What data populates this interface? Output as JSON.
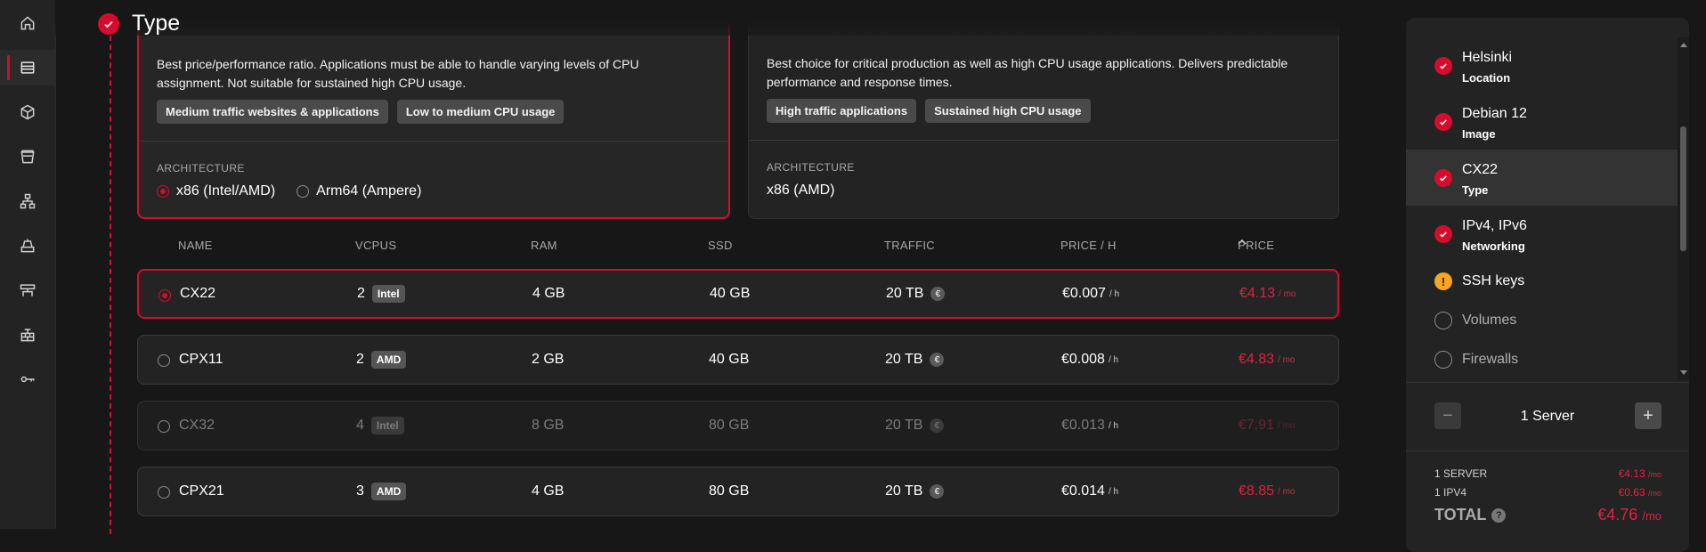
{
  "section": {
    "title": "Type"
  },
  "type_cards": [
    {
      "description": "Best price/performance ratio. Applications must be able to handle varying levels of CPU assignment. Not suitable for sustained high CPU usage.",
      "tags": [
        "Medium traffic websites & applications",
        "Low to medium CPU usage"
      ],
      "arch_label": "ARCHITECTURE",
      "arch_options": [
        "x86 (Intel/AMD)",
        "Arm64 (Ampere)"
      ]
    },
    {
      "description": "Best choice for critical production as well as high CPU usage applications. Delivers predictable performance and response times.",
      "tags": [
        "High traffic applications",
        "Sustained high CPU usage"
      ],
      "arch_label": "ARCHITECTURE",
      "arch_value": "x86 (AMD)"
    }
  ],
  "table": {
    "headers": {
      "name": "NAME",
      "vcpus": "VCPUS",
      "ram": "RAM",
      "ssd": "SSD",
      "traffic": "TRAFFIC",
      "price_h": "PRICE / H",
      "price": "PRICE"
    },
    "rows": [
      {
        "name": "CX22",
        "vcpus": "2",
        "cpu": "Intel",
        "ram": "4 GB",
        "ssd": "40 GB",
        "traffic": "20 TB",
        "price_h": "€0.007",
        "price": "€4.13"
      },
      {
        "name": "CPX11",
        "vcpus": "2",
        "cpu": "AMD",
        "ram": "2 GB",
        "ssd": "40 GB",
        "traffic": "20 TB",
        "price_h": "€0.008",
        "price": "€4.83"
      },
      {
        "name": "CX32",
        "vcpus": "4",
        "cpu": "Intel",
        "ram": "8 GB",
        "ssd": "80 GB",
        "traffic": "20 TB",
        "price_h": "€0.013",
        "price": "€7.91"
      },
      {
        "name": "CPX21",
        "vcpus": "3",
        "cpu": "AMD",
        "ram": "4 GB",
        "ssd": "80 GB",
        "traffic": "20 TB",
        "price_h": "€0.014",
        "price": "€8.85"
      }
    ],
    "unit_h": "/ h",
    "unit_mo": "/ mo",
    "euro_symbol": "€"
  },
  "summary_panel": {
    "steps": [
      {
        "title": "Helsinki",
        "subtitle": "Location",
        "state": "done"
      },
      {
        "title": "Debian 12",
        "subtitle": "Image",
        "state": "done"
      },
      {
        "title": "CX22",
        "subtitle": "Type",
        "state": "done"
      },
      {
        "title": "IPv4, IPv6",
        "subtitle": "Networking",
        "state": "done"
      },
      {
        "title": "SSH keys",
        "state": "warning"
      },
      {
        "title": "Volumes",
        "state": "empty"
      },
      {
        "title": "Firewalls",
        "state": "empty"
      }
    ],
    "warn_symbol": "!",
    "quantity": {
      "minus": "−",
      "plus": "+",
      "label": "1 Server"
    },
    "costs": [
      {
        "label": "1 SERVER",
        "value": "€4.13",
        "unit": "/mo"
      },
      {
        "label": "1 IPV4",
        "value": "€0.63",
        "unit": "/mo"
      }
    ],
    "total": {
      "label": "TOTAL",
      "help": "?",
      "value": "€4.76",
      "unit": "/mo"
    }
  },
  "colors": {
    "accent": "#d50c2d",
    "warning": "#f5a623",
    "background": "#171717"
  }
}
